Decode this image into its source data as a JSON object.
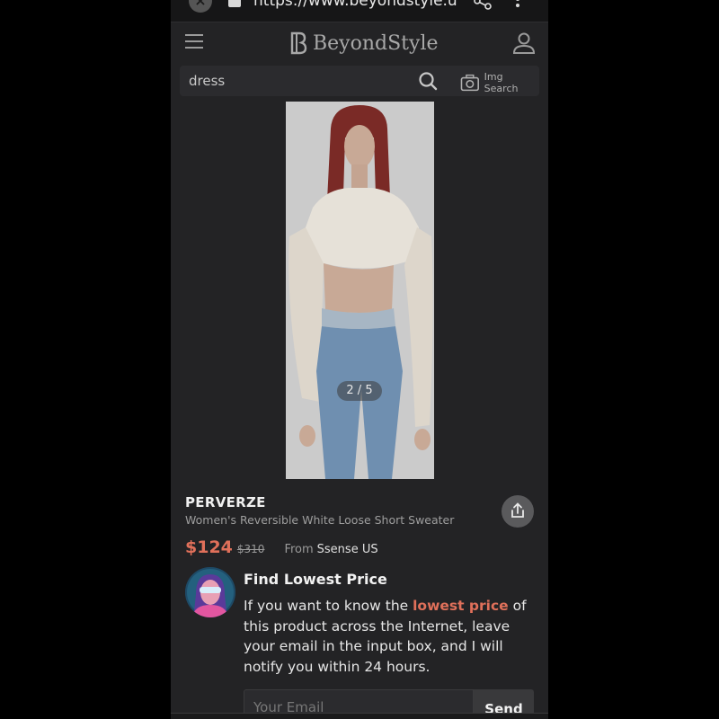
{
  "browser": {
    "close_label": "×",
    "url": "https://www.beyondstyle.us/p"
  },
  "header": {
    "logo_text": "BeyondStyle"
  },
  "search": {
    "value": "dress",
    "img_search_label": "Img Search"
  },
  "gallery": {
    "counter": "2 / 5"
  },
  "product": {
    "brand": "PERVERZE",
    "name": "Women's Reversible White Loose Short Sweater",
    "price": "$124",
    "original_price": "$310",
    "from_label": "From",
    "store": "Ssense US"
  },
  "lowest_price": {
    "title": "Find Lowest Price",
    "text_before": "If you want to know the ",
    "highlight": "lowest price",
    "text_after": " of this product across the Internet, leave your email in the input box, and I will notify you within 24 hours.",
    "email_placeholder": "Your Email",
    "send_label": "Send"
  },
  "colors": {
    "background": "#232325",
    "accent": "#e0705a"
  }
}
